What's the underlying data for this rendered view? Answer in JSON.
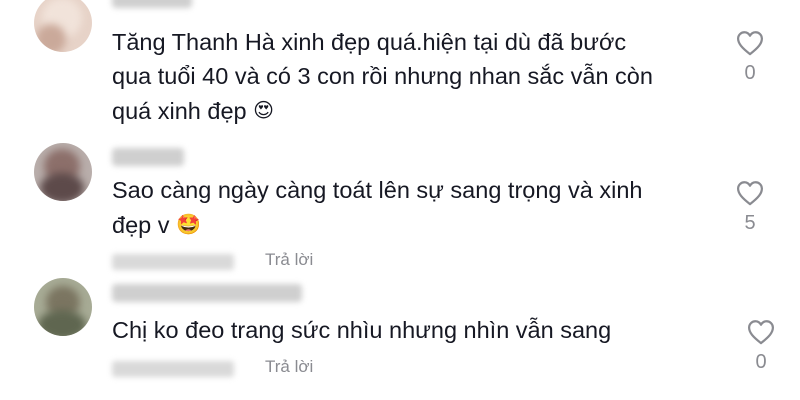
{
  "comments": [
    {
      "text_lines": [
        "Tăng Thanh Hà xinh đẹp quá.hiện tại dù đã bước",
        "qua tuổi 40 và có 3 con rồi nhưng nhan sắc vẫn còn",
        "quá xinh đẹp"
      ],
      "emoji": "😍",
      "emoji_icon": "heart-eyes-emoji",
      "like_count": "0"
    },
    {
      "text_lines": [
        "Sao càng ngày càng toát lên sự sang trọng và xinh",
        "đẹp v"
      ],
      "emoji": "🤩",
      "emoji_icon": "star-struck-emoji",
      "reply_label": "Trả lời",
      "like_count": "5"
    },
    {
      "text_lines": [
        "Chị ko đeo trang sức nhìu nhưng nhìn vẫn sang"
      ],
      "reply_label": "Trả lời",
      "like_count": "0"
    }
  ],
  "icons": {
    "like": "heart-outline-icon"
  },
  "colors": {
    "text": "#161823",
    "secondary": "#8a8b91",
    "icon": "#8a8b91"
  }
}
